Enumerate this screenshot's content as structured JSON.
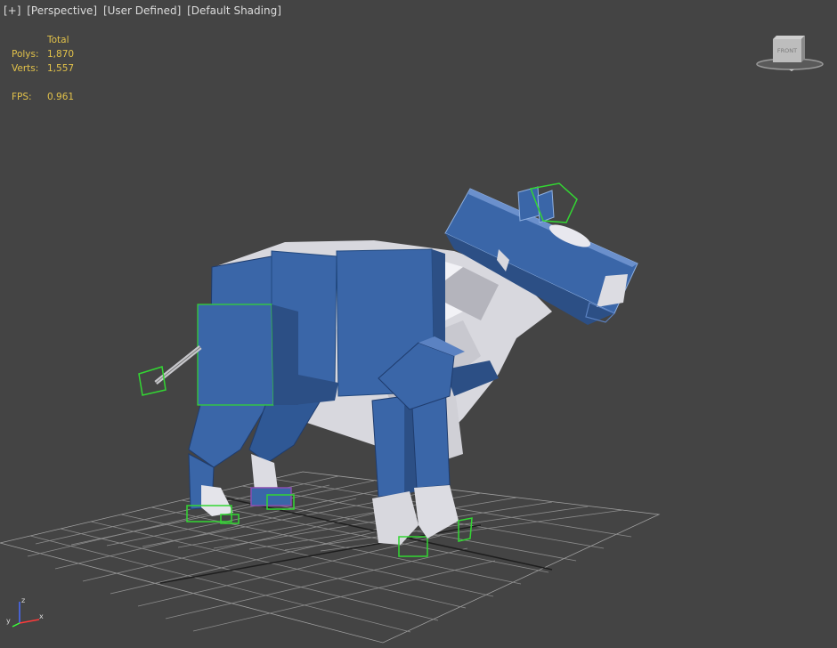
{
  "viewport": {
    "labels": {
      "plus": "[+]",
      "view": "[Perspective]",
      "camera": "[User Defined]",
      "shading": "[Default Shading]"
    },
    "stats": {
      "header": "Total",
      "polys_label": "Polys:",
      "polys_value": "1,870",
      "verts_label": "Verts:",
      "verts_value": "1,557",
      "fps_label": "FPS:",
      "fps_value": "0.961"
    },
    "viewcube": {
      "front": "FRONT",
      "left": "LEFT"
    },
    "axis_tripod": {
      "x": "x",
      "y": "y",
      "z": "z"
    },
    "colors": {
      "background": "#444444",
      "stat_text": "#e2c24a",
      "label_text": "#dcdcdc",
      "model_blue": "#3a66a8",
      "selection_green": "#33d633"
    }
  }
}
